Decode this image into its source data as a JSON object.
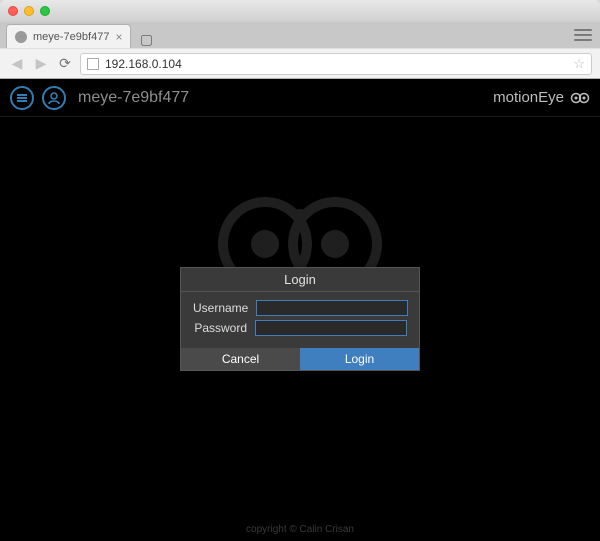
{
  "browser": {
    "tab_title": "meye-7e9bf477",
    "url": "192.168.0.104"
  },
  "app": {
    "menu_icon": "hamburger-icon",
    "user_icon": "user-icon",
    "host_title": "meye-7e9bf477",
    "brand": "motionEye"
  },
  "login": {
    "title": "Login",
    "username_label": "Username",
    "password_label": "Password",
    "username_value": "",
    "password_value": "",
    "cancel_label": "Cancel",
    "login_label": "Login"
  },
  "footer": {
    "text": "copyright © Calin Crisan"
  },
  "colors": {
    "accent": "#3f7fbf",
    "header_icon": "#2f7db3",
    "bg": "#000000",
    "dialog_bg": "#3a3a3a"
  }
}
